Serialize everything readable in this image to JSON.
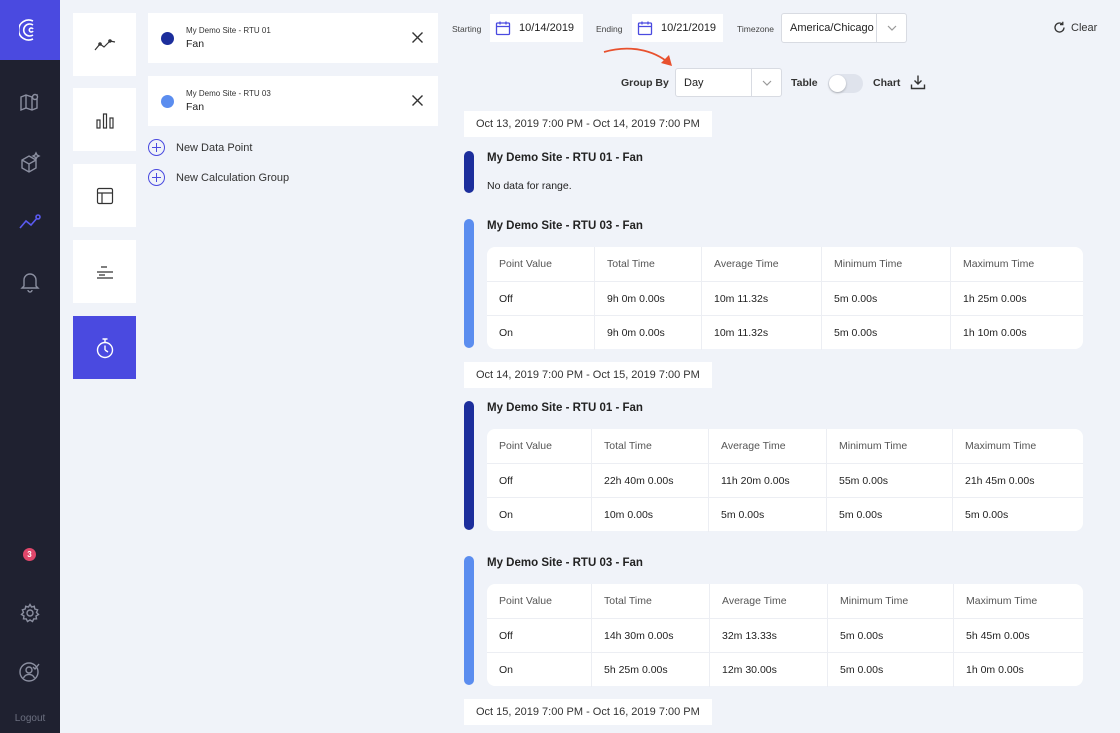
{
  "nav": {
    "logout_label": "Logout",
    "badge_count": "3"
  },
  "data_points": [
    {
      "site": "My Demo Site - RTU 01",
      "point": "Fan",
      "color": "#1c2e9c"
    },
    {
      "site": "My Demo Site - RTU 03",
      "point": "Fan",
      "color": "#5b8def"
    }
  ],
  "actions": {
    "new_data_point": "New Data Point",
    "new_calc_group": "New Calculation Group"
  },
  "filters": {
    "starting_label": "Starting",
    "starting_value": "10/14/2019",
    "ending_label": "Ending",
    "ending_value": "10/21/2019",
    "timezone_label": "Timezone",
    "timezone_value": "America/Chicago",
    "clear_label": "Clear",
    "group_by_label": "Group By",
    "group_by_value": "Day",
    "table_label": "Table",
    "chart_label": "Chart"
  },
  "results": [
    {
      "range": "Oct 13, 2019 7:00 PM - Oct 14, 2019 7:00 PM",
      "sections": [
        {
          "title": "My Demo Site - RTU 01 - Fan",
          "nodata": "No data for range."
        },
        {
          "title": "My Demo Site - RTU 03 - Fan",
          "headers": [
            "Point Value",
            "Total Time",
            "Average Time",
            "Minimum Time",
            "Maximum Time"
          ],
          "rows": [
            [
              "Off",
              "9h 0m 0.00s",
              "10m 11.32s",
              "5m 0.00s",
              "1h 25m 0.00s"
            ],
            [
              "On",
              "9h 0m 0.00s",
              "10m 11.32s",
              "5m 0.00s",
              "1h 10m 0.00s"
            ]
          ]
        }
      ]
    },
    {
      "range": "Oct 14, 2019 7:00 PM - Oct 15, 2019 7:00 PM",
      "sections": [
        {
          "title": "My Demo Site - RTU 01 - Fan",
          "headers": [
            "Point Value",
            "Total Time",
            "Average Time",
            "Minimum Time",
            "Maximum Time"
          ],
          "rows": [
            [
              "Off",
              "22h 40m 0.00s",
              "11h 20m 0.00s",
              "55m 0.00s",
              "21h 45m 0.00s"
            ],
            [
              "On",
              "10m 0.00s",
              "5m 0.00s",
              "5m 0.00s",
              "5m 0.00s"
            ]
          ]
        },
        {
          "title": "My Demo Site - RTU 03 - Fan",
          "headers": [
            "Point Value",
            "Total Time",
            "Average Time",
            "Minimum Time",
            "Maximum Time"
          ],
          "rows": [
            [
              "Off",
              "14h 30m 0.00s",
              "32m 13.33s",
              "5m 0.00s",
              "5h 45m 0.00s"
            ],
            [
              "On",
              "5h 25m 0.00s",
              "12m 30.00s",
              "5m 0.00s",
              "1h 0m 0.00s"
            ]
          ]
        }
      ]
    },
    {
      "range": "Oct 15, 2019 7:00 PM - Oct 16, 2019 7:00 PM",
      "sections": []
    }
  ],
  "colors": {
    "accent": "#4a4ae0",
    "nav_bg": "#1f2130",
    "rtu01": "#1c2e9c",
    "rtu03": "#5b8def",
    "annotation_arrow": "#e8512e"
  }
}
